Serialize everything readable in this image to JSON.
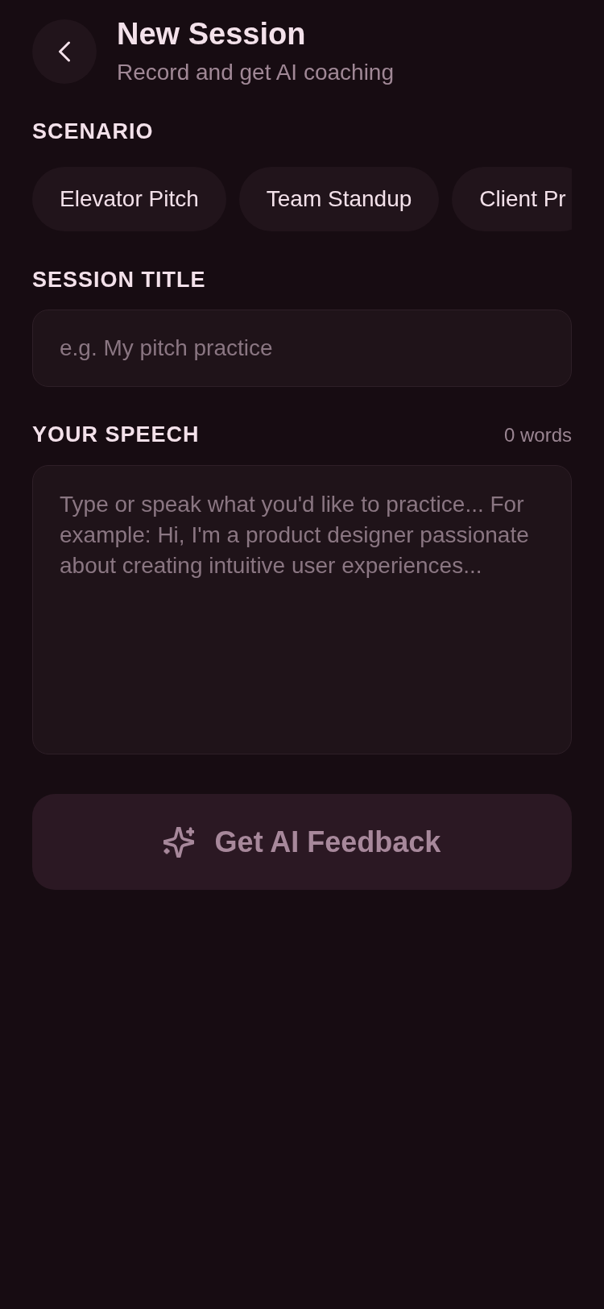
{
  "header": {
    "title": "New Session",
    "subtitle": "Record and get AI coaching"
  },
  "scenario": {
    "label": "SCENARIO",
    "options": [
      {
        "label": "Elevator Pitch",
        "selected": false
      },
      {
        "label": "Team Standup",
        "selected": false
      },
      {
        "label": "Client Pr",
        "selected": false
      }
    ]
  },
  "session_title": {
    "label": "SESSION TITLE",
    "placeholder": "e.g. My pitch practice"
  },
  "speech": {
    "label": "YOUR SPEECH",
    "word_count": "0 words",
    "placeholder": "Type or speak what you'd like to practice... For example: Hi, I'm a product designer passionate about creating intuitive user experiences..."
  },
  "submit_button": {
    "label": "Get AI Feedback",
    "disabled": true
  }
}
